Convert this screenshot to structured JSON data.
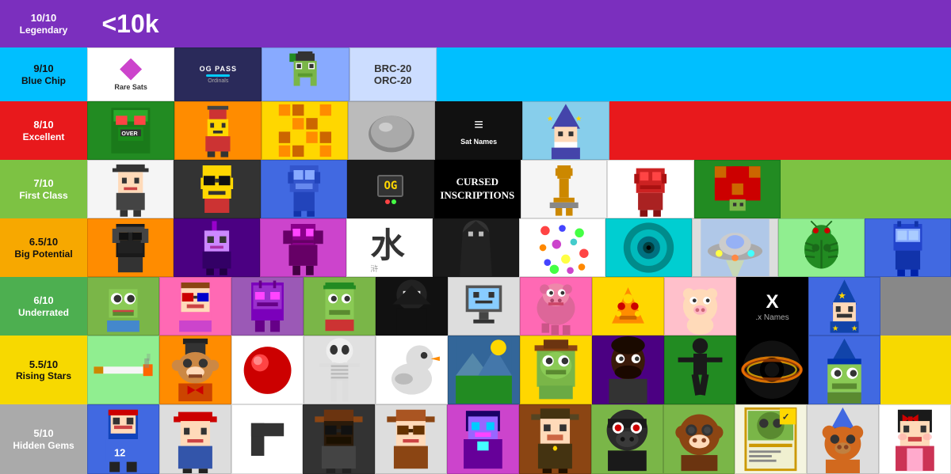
{
  "tiers": [
    {
      "id": "legendary",
      "score": "10/10",
      "name": "Legendary",
      "rowClass": "row-legendary",
      "labelColor": "white",
      "special": "<10k",
      "cells": [
        {
          "id": "c10k",
          "type": "text",
          "text": "<10k",
          "bg": "#7B2FBE",
          "textColor": "white",
          "fontSize": 28
        },
        {
          "id": "empty1",
          "type": "empty",
          "bg": "#7B2FBE"
        },
        {
          "id": "empty2",
          "type": "empty",
          "bg": "#7B2FBE"
        },
        {
          "id": "empty3",
          "type": "empty",
          "bg": "#7B2FBE"
        },
        {
          "id": "empty4",
          "type": "empty",
          "bg": "#7B2FBE"
        },
        {
          "id": "empty5",
          "type": "empty",
          "bg": "#7B2FBE"
        },
        {
          "id": "empty6",
          "type": "empty",
          "bg": "#7B2FBE"
        },
        {
          "id": "empty7",
          "type": "empty",
          "bg": "#7B2FBE"
        },
        {
          "id": "empty8",
          "type": "empty",
          "bg": "#7B2FBE"
        },
        {
          "id": "empty9",
          "type": "empty",
          "bg": "#7B2FBE"
        }
      ]
    },
    {
      "id": "bluechip",
      "score": "9/10",
      "name": "Blue Chip",
      "rowClass": "row-bluechip",
      "cells": [
        {
          "id": "raresats",
          "type": "raresats",
          "bg": "#fff"
        },
        {
          "id": "ogpass",
          "type": "ogpass",
          "bg": "#2a2a5a"
        },
        {
          "id": "pixelfrog",
          "type": "pixel-char",
          "bg": "#88AAFF",
          "char": "frog"
        },
        {
          "id": "brc20",
          "type": "brc20",
          "bg": "#CCDDFF"
        },
        {
          "id": "empty_bc1",
          "type": "empty",
          "bg": "#00BFFF"
        },
        {
          "id": "empty_bc2",
          "type": "empty",
          "bg": "#00BFFF"
        },
        {
          "id": "empty_bc3",
          "type": "empty",
          "bg": "#00BFFF"
        },
        {
          "id": "empty_bc4",
          "type": "empty",
          "bg": "#00BFFF"
        },
        {
          "id": "empty_bc5",
          "type": "empty",
          "bg": "#00BFFF"
        },
        {
          "id": "empty_bc6",
          "type": "empty",
          "bg": "#00BFFF"
        }
      ]
    },
    {
      "id": "excellent",
      "score": "8/10",
      "name": "Excellent",
      "rowClass": "row-excellent",
      "cells": [
        {
          "id": "over_char",
          "type": "pixel-char",
          "bg": "#228B22",
          "char": "robot-green"
        },
        {
          "id": "pixel_girl",
          "type": "pixel-char",
          "bg": "#FF8C00",
          "char": "pixel-girl"
        },
        {
          "id": "pixel_gold",
          "type": "pixel-char",
          "bg": "#FFD700",
          "char": "gold-squares"
        },
        {
          "id": "rock",
          "type": "pixel-char",
          "bg": "#999",
          "char": "rock"
        },
        {
          "id": "satnames",
          "type": "satnames",
          "bg": "#111"
        },
        {
          "id": "wizard",
          "type": "pixel-char",
          "bg": "#87CEEB",
          "char": "wizard"
        },
        {
          "id": "empty_ex1",
          "type": "empty",
          "bg": "#E8191C"
        },
        {
          "id": "empty_ex2",
          "type": "empty",
          "bg": "#E8191C"
        },
        {
          "id": "empty_ex3",
          "type": "empty",
          "bg": "#E8191C"
        },
        {
          "id": "empty_ex4",
          "type": "empty",
          "bg": "#E8191C"
        }
      ]
    },
    {
      "id": "firstclass",
      "score": "7/10",
      "name": "First Class",
      "rowClass": "row-firstclass",
      "cells": [
        {
          "id": "hat_guy",
          "type": "pixel-char",
          "bg": "#f5f5f5",
          "char": "hat-guy"
        },
        {
          "id": "yellow_face",
          "type": "pixel-char",
          "bg": "#333",
          "char": "yellow-face"
        },
        {
          "id": "blue_robot",
          "type": "pixel-char",
          "bg": "#4169E1",
          "char": "blue-robot"
        },
        {
          "id": "retro_game",
          "type": "pixel-char",
          "bg": "#1a1a1a",
          "char": "retro-og"
        },
        {
          "id": "cursed",
          "type": "cursed",
          "bg": "#000"
        },
        {
          "id": "pixel_trophy",
          "type": "pixel-char",
          "bg": "#f5f5f5",
          "char": "pixel-trophy"
        },
        {
          "id": "red_robot",
          "type": "pixel-char",
          "bg": "#fff",
          "char": "red-robot"
        },
        {
          "id": "turtle_char",
          "type": "pixel-char",
          "bg": "#228B22",
          "char": "turtle"
        },
        {
          "id": "empty_fc1",
          "type": "empty",
          "bg": "#7DC243"
        },
        {
          "id": "empty_fc2",
          "type": "empty",
          "bg": "#7DC243"
        }
      ]
    },
    {
      "id": "bigpotential",
      "score": "6.5/10",
      "name": "Big Potential",
      "rowClass": "row-bigpotential",
      "cells": [
        {
          "id": "dj_char",
          "type": "pixel-char",
          "bg": "#FF8C00",
          "char": "dj"
        },
        {
          "id": "punk_char",
          "type": "pixel-char",
          "bg": "#4B0082",
          "char": "punk"
        },
        {
          "id": "mech_char",
          "type": "pixel-char",
          "bg": "#CC44CC",
          "char": "mech"
        },
        {
          "id": "calligraphy",
          "type": "pixel-char",
          "bg": "#fff",
          "char": "calligraphy"
        },
        {
          "id": "dark_figure",
          "type": "pixel-char",
          "bg": "#1a1a1a",
          "char": "dark-figure"
        },
        {
          "id": "confetti",
          "type": "pixel-char",
          "bg": "#fff",
          "char": "confetti"
        },
        {
          "id": "swirl",
          "type": "pixel-char",
          "bg": "#00CED1",
          "char": "swirl"
        },
        {
          "id": "ufo",
          "type": "pixel-char",
          "bg": "#ddd",
          "char": "ufo"
        },
        {
          "id": "beetle",
          "type": "pixel-char",
          "bg": "#90EE90",
          "char": "beetle"
        },
        {
          "id": "blue_robot2",
          "type": "pixel-char",
          "bg": "#4169E1",
          "char": "blue-bot"
        }
      ]
    },
    {
      "id": "underrated",
      "score": "6/10",
      "name": "Underrated",
      "rowClass": "row-underrated",
      "cells": [
        {
          "id": "pepe1",
          "type": "pixel-char",
          "bg": "#7ab648",
          "char": "pepe"
        },
        {
          "id": "3d_glasses",
          "type": "pixel-char",
          "bg": "#FF69B4",
          "char": "3d-glasses"
        },
        {
          "id": "purple_alien",
          "type": "pixel-char",
          "bg": "#9B59B6",
          "char": "alien"
        },
        {
          "id": "pepe2",
          "type": "pixel-char",
          "bg": "#7ab648",
          "char": "pepe-hat"
        },
        {
          "id": "dark_figure2",
          "type": "pixel-char",
          "bg": "#111",
          "char": "dark-fig2"
        },
        {
          "id": "screen_char",
          "type": "pixel-char",
          "bg": "#ddd",
          "char": "screen"
        },
        {
          "id": "hippo",
          "type": "pixel-char",
          "bg": "#FF69B4",
          "char": "hippo"
        },
        {
          "id": "pizza",
          "type": "pixel-char",
          "bg": "#FFD700",
          "char": "pizza"
        },
        {
          "id": "pig_char",
          "type": "pixel-char",
          "bg": "#FFC0CB",
          "char": "pig"
        },
        {
          "id": "xnames",
          "type": "xnames",
          "bg": "#000"
        },
        {
          "id": "wizard2",
          "type": "pixel-char",
          "bg": "#4169E1",
          "char": "wizard2"
        },
        {
          "id": "empty_ur1",
          "type": "empty",
          "bg": "#aaa"
        }
      ]
    },
    {
      "id": "risingstars",
      "score": "5.5/10",
      "name": "Rising Stars",
      "rowClass": "row-risingstars",
      "cells": [
        {
          "id": "cigarette",
          "type": "pixel-char",
          "bg": "#90EE90",
          "char": "cigarette"
        },
        {
          "id": "monkey_char",
          "type": "pixel-char",
          "bg": "#FF8C00",
          "char": "monkey"
        },
        {
          "id": "ball_char",
          "type": "pixel-char",
          "bg": "#fff",
          "char": "ball"
        },
        {
          "id": "skeleton",
          "type": "pixel-char",
          "bg": "#e0e0e0",
          "char": "skeleton"
        },
        {
          "id": "duck_char",
          "type": "pixel-char",
          "bg": "#fff",
          "char": "duck"
        },
        {
          "id": "landscape",
          "type": "pixel-char",
          "bg": "#336699",
          "char": "landscape"
        },
        {
          "id": "frog_yellow",
          "type": "pixel-char",
          "bg": "#FFD700",
          "char": "frog-yellow"
        },
        {
          "id": "black_man",
          "type": "pixel-char",
          "bg": "#4B0082",
          "char": "black-man"
        },
        {
          "id": "dancer",
          "type": "pixel-char",
          "bg": "#228B22",
          "char": "dancer"
        },
        {
          "id": "black_hole",
          "type": "pixel-char",
          "bg": "#000",
          "char": "black-hole"
        },
        {
          "id": "frog_hat",
          "type": "pixel-char",
          "bg": "#4169E1",
          "char": "frog-hat"
        },
        {
          "id": "empty_rs1",
          "type": "empty",
          "bg": "#F7D900"
        }
      ]
    },
    {
      "id": "hiddengems",
      "score": "5/10",
      "name": "Hidden Gems",
      "rowClass": "row-hiddengems",
      "cells": [
        {
          "id": "pixel_man",
          "type": "pixel-char",
          "bg": "#4169E1",
          "char": "pixel-man"
        },
        {
          "id": "red_hat",
          "type": "pixel-char",
          "bg": "#ddd",
          "char": "red-hat"
        },
        {
          "id": "white_shape",
          "type": "pixel-char",
          "bg": "#fff",
          "char": "white-shape"
        },
        {
          "id": "cowboy1",
          "type": "pixel-char",
          "bg": "#333",
          "char": "cowboy1"
        },
        {
          "id": "cowboy2",
          "type": "pixel-char",
          "bg": "#ddd",
          "char": "cowboy2"
        },
        {
          "id": "blue_lady",
          "type": "pixel-char",
          "bg": "#CC44CC",
          "char": "blue-lady"
        },
        {
          "id": "pixel_cowboy",
          "type": "pixel-char",
          "bg": "#8B4513",
          "char": "pixel-cowboy"
        },
        {
          "id": "zombie",
          "type": "pixel-char",
          "bg": "#7ab648",
          "char": "zombie"
        },
        {
          "id": "monkey2",
          "type": "pixel-char",
          "bg": "#7ab648",
          "char": "monkey2"
        },
        {
          "id": "swamp_card",
          "type": "pixel-char",
          "bg": "#f5f5e0",
          "char": "swamp-card"
        },
        {
          "id": "bear_char",
          "type": "pixel-char",
          "bg": "#ddd",
          "char": "bear"
        },
        {
          "id": "japan_doll",
          "type": "pixel-char",
          "bg": "#fff",
          "char": "japan-doll"
        }
      ]
    }
  ],
  "labels": {
    "legendary": {
      "score": "10/10",
      "name": "Legendary"
    },
    "bluechip": {
      "score": "9/10",
      "name": "Blue Chip"
    },
    "excellent": {
      "score": "8/10",
      "name": "Excellent"
    },
    "firstclass": {
      "score": "7/10",
      "name": "First Class"
    },
    "bigpotential": {
      "score": "6.5/10",
      "name": "Big Potential"
    },
    "underrated": {
      "score": "6/10",
      "name": "Underrated"
    },
    "risingstars": {
      "score": "5.5/10",
      "name": "Rising Stars"
    },
    "hiddengems": {
      "score": "5/10",
      "name": "Hidden Gems"
    }
  },
  "special_text": {
    "ten_k": "<10k",
    "cursed_line1": "CURSED",
    "cursed_line2": "INSCRIPTIONS",
    "brc20_line1": "BRC-20",
    "brc20_line2": "ORC-20",
    "x_names": ".x Names",
    "x_symbol": "X",
    "raresats_label": "Rare Sats",
    "ogpass_label": "OG PASS",
    "satnames_symbol": "≡",
    "satnames_label": "Sat Names"
  },
  "colors": {
    "legendary_bg": "#7B2FBE",
    "bluechip_bg": "#00BFFF",
    "excellent_bg": "#E8191C",
    "firstclass_bg": "#7DC243",
    "bigpotential_bg": "#F7A800",
    "underrated_bg": "#4DAF50",
    "risingstars_bg": "#F7D900",
    "hiddengems_bg": "#AAAAAA"
  }
}
